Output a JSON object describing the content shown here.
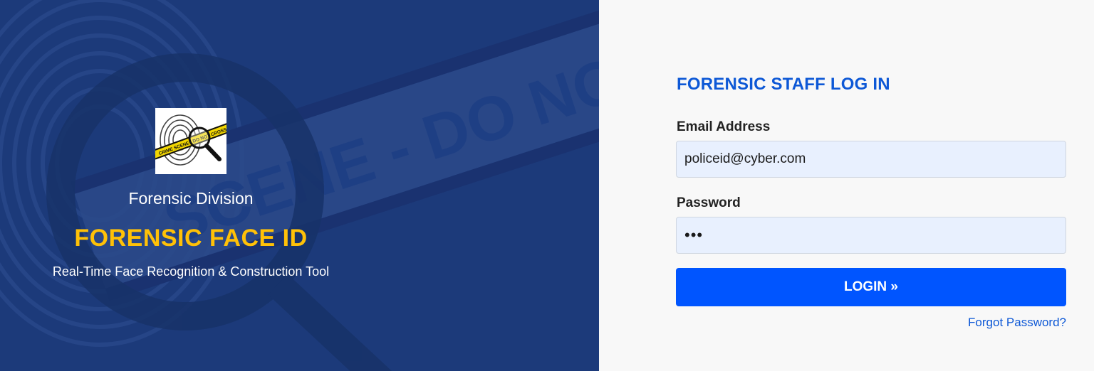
{
  "brand": {
    "logo_icon": "fingerprint-magnifier-crime-tape-logo",
    "logo_tape_text": "CRIME SCENE - DO NOT CROSS",
    "division": "Forensic Division",
    "app_title": "FORENSIC FACE ID",
    "tagline": "Real-Time Face Recognition & Construction Tool"
  },
  "background": {
    "tape_text": "SCENE - DO NOT CROSS   CRIME"
  },
  "login": {
    "title": "FORENSIC STAFF LOG IN",
    "email_label": "Email Address",
    "email_value": "policeid@cyber.com",
    "password_label": "Password",
    "password_value": "•••",
    "login_button": "LOGIN »",
    "forgot_link": "Forgot Password?"
  },
  "colors": {
    "left_bg": "#1c3a7a",
    "title_yellow": "#ffc107",
    "accent_blue": "#0055ff",
    "link_blue": "#0d58d6",
    "input_bg": "#e8f0fe"
  }
}
